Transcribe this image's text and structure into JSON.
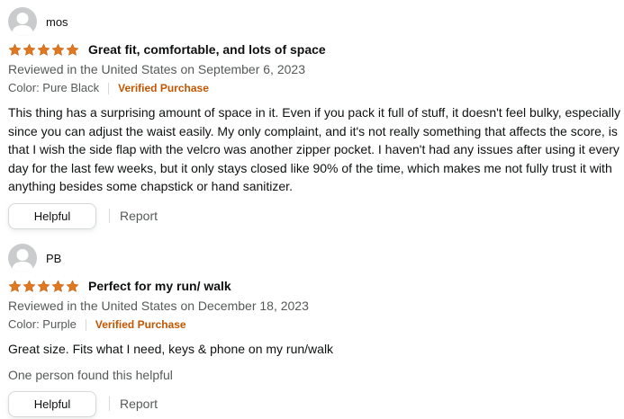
{
  "reviews": [
    {
      "profile_name": "mos",
      "rating": 5,
      "title": "Great fit, comfortable, and lots of space",
      "date": "Reviewed in the United States on September 6, 2023",
      "variant": "Color: Pure Black",
      "verified_label": "Verified Purchase",
      "body": "This thing has a surprising amount of space in it. Even if you pack it full of stuff, it doesn't feel bulky, especially since you can adjust the waist easily. My only complaint, and it's not really something that affects the score, is that I wish the side flap with the velcro was another zipper pocket. I haven't had any issues after using it every day for the last few weeks, but it only stays closed like 90% of the time, which makes me not fully trust it with anything besides some chapstick or hand sanitizer.",
      "helpful_button_label": "Helpful",
      "report_label": "Report"
    },
    {
      "profile_name": "PB",
      "rating": 5,
      "title": "Perfect for my run/ walk",
      "date": "Reviewed in the United States on December 18, 2023",
      "variant": "Color: Purple",
      "verified_label": "Verified Purchase",
      "body": "Great size. Fits what I need, keys & phone on my run/walk",
      "helpful_count_text": "One person found this helpful",
      "helpful_button_label": "Helpful",
      "report_label": "Report"
    }
  ],
  "colors": {
    "star_fill": "#de7921",
    "verified": "#c45500",
    "secondary_text": "#565959",
    "avatar_bg": "#c9cccc"
  },
  "icons": {
    "avatar": "default-avatar-icon",
    "star": "star-filled-icon"
  }
}
